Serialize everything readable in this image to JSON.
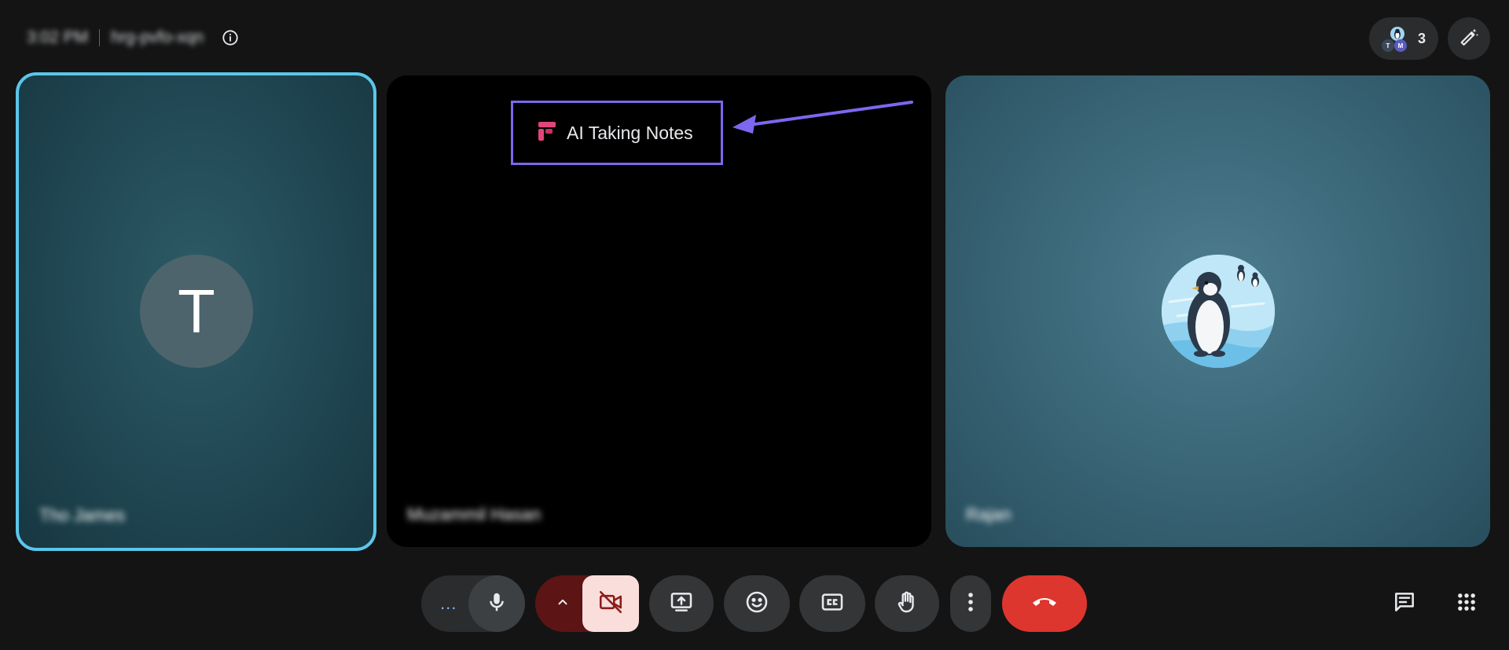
{
  "meeting": {
    "time": "3:02 PM",
    "code": "hrg-pvfo-xqn"
  },
  "people": {
    "count": "3",
    "mini_avatars": [
      "T",
      "M"
    ]
  },
  "tiles": [
    {
      "name": "Tho James",
      "avatar_letter": "T",
      "active_speaker": true
    },
    {
      "name": "Muzammil Hasan",
      "camera": "off"
    },
    {
      "name": "Rajan",
      "avatar": "penguin-image"
    }
  ],
  "ai_badge": {
    "label": "AI Taking Notes",
    "icon": "fireflies-logo-icon",
    "outline_color": "#7b68ee"
  },
  "controls": {
    "more_options": "...",
    "microphone": "on",
    "camera": "off"
  },
  "colors": {
    "active_speaker_border": "#5bc6ea",
    "end_call": "#dc362e",
    "camera_off_bg": "#f9dedc",
    "camera_off_icon": "#8c1d18"
  }
}
